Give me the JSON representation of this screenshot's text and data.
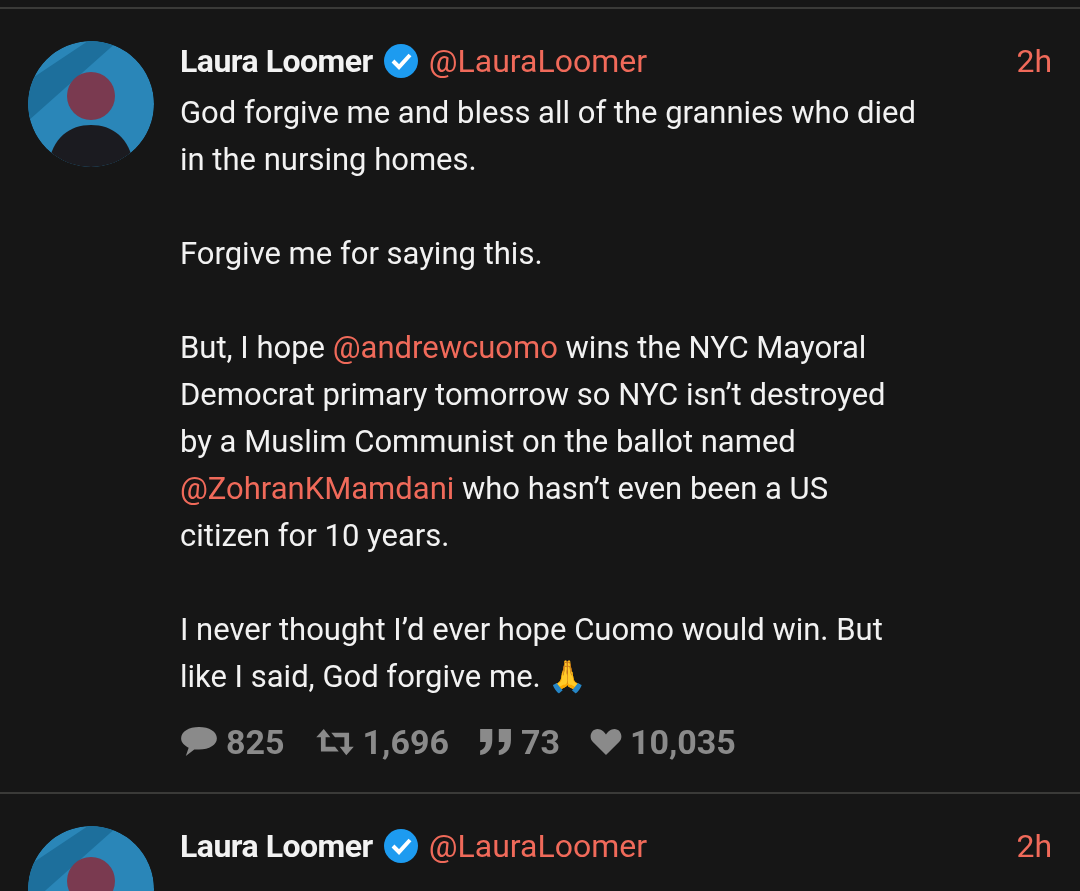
{
  "tweets": [
    {
      "name": "Laura Loomer",
      "verified": true,
      "handle": "@LauraLoomer",
      "time": "2h",
      "paragraphs": [
        [
          [
            {
              "kind": "text",
              "text": "God forgive me and bless all of the grannies who died"
            }
          ],
          [
            {
              "kind": "text",
              "text": "in the nursing homes."
            }
          ]
        ],
        [
          [
            {
              "kind": "text",
              "text": "Forgive me for saying this."
            }
          ]
        ],
        [
          [
            {
              "kind": "text",
              "text": "But, I hope "
            },
            {
              "kind": "mention",
              "text": "@andrewcuomo"
            },
            {
              "kind": "text",
              "text": " wins the NYC Mayoral"
            }
          ],
          [
            {
              "kind": "text",
              "text": "Democrat primary tomorrow so NYC isn’t destroyed"
            }
          ],
          [
            {
              "kind": "text",
              "text": "by a Muslim Communist on the ballot named"
            }
          ],
          [
            {
              "kind": "mention",
              "text": "@ZohranKMamdani"
            },
            {
              "kind": "text",
              "text": " who hasn’t even been a US"
            }
          ],
          [
            {
              "kind": "text",
              "text": "citizen for 10 years."
            }
          ]
        ],
        [
          [
            {
              "kind": "text",
              "text": "I never thought I’d ever hope Cuomo would win. But"
            }
          ],
          [
            {
              "kind": "text",
              "text": "like I said, God forgive me. 🙏"
            }
          ]
        ]
      ],
      "stats": [
        {
          "kind": "reply",
          "count": "825"
        },
        {
          "kind": "retweet",
          "count": "1,696"
        },
        {
          "kind": "quote",
          "count": "73"
        },
        {
          "kind": "like",
          "count": "10,035"
        }
      ]
    },
    {
      "name": "Laura Loomer",
      "verified": true,
      "handle": "@LauraLoomer",
      "time": "2h"
    }
  ]
}
